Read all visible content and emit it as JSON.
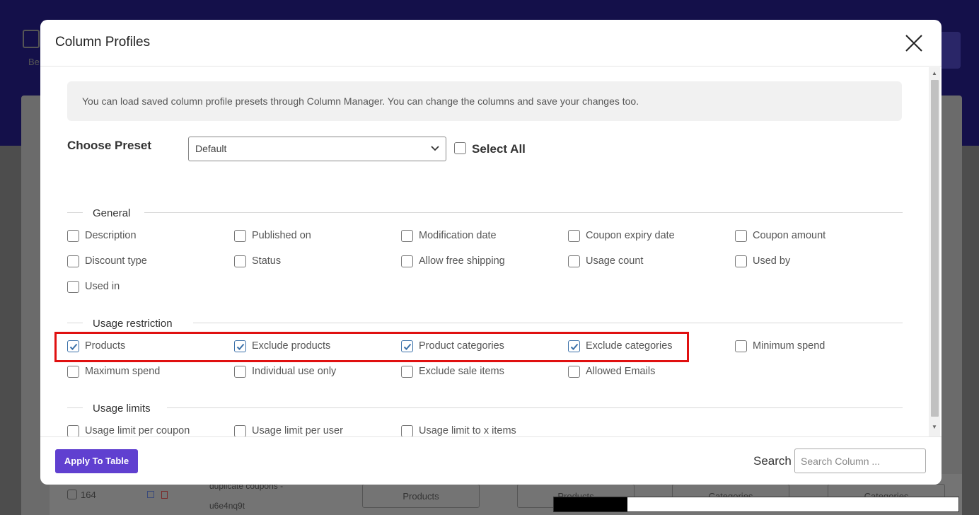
{
  "background": {
    "icon_label": "Be",
    "row_number": "164",
    "row_text_line1": "duplicate coupons -",
    "row_text_line2": "u6e4nq9t",
    "row_buttons": [
      "Products",
      "Products",
      "Categories",
      "Categories"
    ]
  },
  "modal": {
    "title": "Column Profiles",
    "info_text": "You can load saved column profile presets through Column Manager. You can change the columns and save your changes too.",
    "preset": {
      "label": "Choose Preset",
      "selected": "Default",
      "select_all_label": "Select All",
      "select_all_checked": false
    },
    "sections": {
      "general": {
        "title": "General",
        "items": [
          {
            "label": "Description",
            "checked": false
          },
          {
            "label": "Published on",
            "checked": false
          },
          {
            "label": "Modification date",
            "checked": false
          },
          {
            "label": "Coupon expiry date",
            "checked": false
          },
          {
            "label": "Coupon amount",
            "checked": false
          },
          {
            "label": "Discount type",
            "checked": false
          },
          {
            "label": "Status",
            "checked": false
          },
          {
            "label": "Allow free shipping",
            "checked": false
          },
          {
            "label": "Usage count",
            "checked": false
          },
          {
            "label": "Used by",
            "checked": false
          },
          {
            "label": "Used in",
            "checked": false
          }
        ]
      },
      "usage_restriction": {
        "title": "Usage restriction",
        "items": [
          {
            "label": "Products",
            "checked": true
          },
          {
            "label": "Exclude products",
            "checked": true
          },
          {
            "label": "Product categories",
            "checked": true
          },
          {
            "label": "Exclude categories",
            "checked": true
          },
          {
            "label": "Minimum spend",
            "checked": false
          },
          {
            "label": "Maximum spend",
            "checked": false
          },
          {
            "label": "Individual use only",
            "checked": false
          },
          {
            "label": "Exclude sale items",
            "checked": false
          },
          {
            "label": "Allowed Emails",
            "checked": false
          }
        ]
      },
      "usage_limits": {
        "title": "Usage limits",
        "items": [
          {
            "label": "Usage limit per coupon",
            "checked": false
          },
          {
            "label": "Usage limit per user",
            "checked": false
          },
          {
            "label": "Usage limit to x items",
            "checked": false
          }
        ]
      }
    },
    "footer": {
      "apply_label": "Apply To Table",
      "search_label": "Search",
      "search_placeholder": "Search Column ...",
      "search_value": ""
    }
  },
  "colors": {
    "accent": "#6040d0",
    "checkbox_checked": "#3b71a9",
    "highlight": "#e01010"
  },
  "icons": {
    "close": "close-icon",
    "dropdown": "chevron-down-icon",
    "check": "check-icon"
  }
}
